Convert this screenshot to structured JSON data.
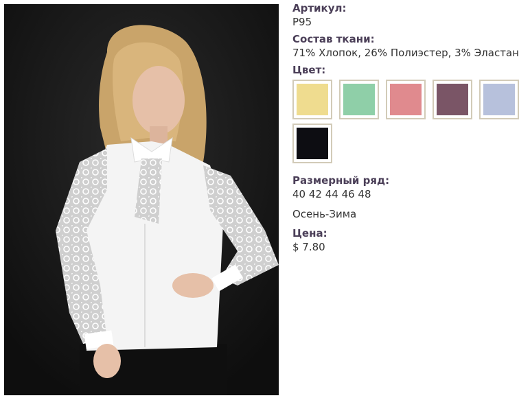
{
  "product": {
    "article_label": "Артикул:",
    "article_value": "P95",
    "fabric_label": "Состав ткани:",
    "fabric_value": "71% Хлопок, 26% Полиэстер, 3% Эластан",
    "color_label": "Цвет:",
    "colors": [
      {
        "name": "yellow",
        "hex": "#efdc8f"
      },
      {
        "name": "mint",
        "hex": "#8fcfa8"
      },
      {
        "name": "pink",
        "hex": "#e08a8e"
      },
      {
        "name": "mauve",
        "hex": "#7a5566"
      },
      {
        "name": "light-blue",
        "hex": "#b7c1dc"
      },
      {
        "name": "black",
        "hex": "#0d0d12"
      }
    ],
    "size_label": "Размерный ряд:",
    "size_value": "40 42 44 46 48",
    "season": "Осень-Зима",
    "price_label": "Цена:",
    "price_value": "$ 7.80"
  }
}
